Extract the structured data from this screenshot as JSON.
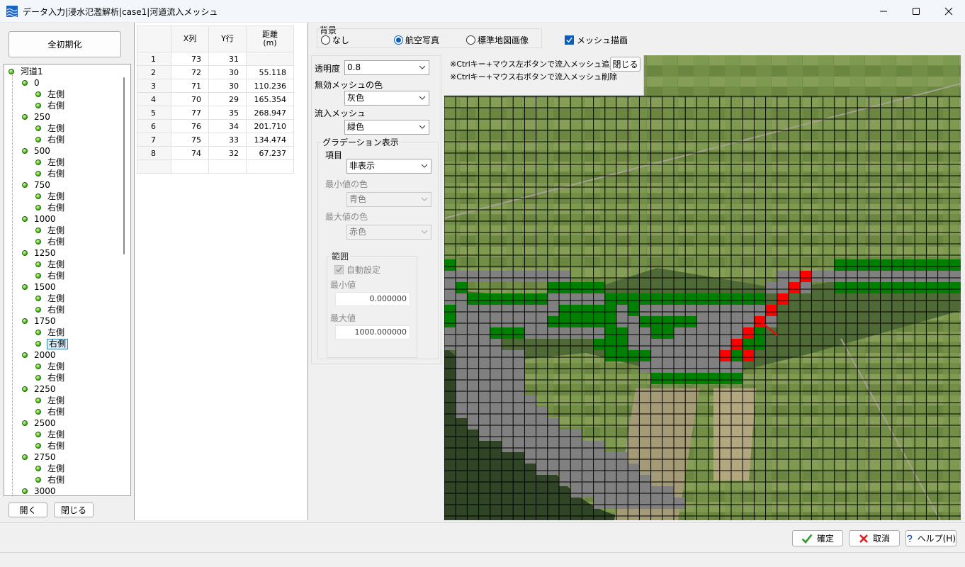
{
  "window": {
    "title": "データ入力|浸水氾濫解析|case1|河道流入メッシュ",
    "minimize": "minimize",
    "maximize": "maximize",
    "close": "close"
  },
  "left": {
    "init_button": "全初期化",
    "open_button": "開く",
    "close_button": "閉じる"
  },
  "tree": {
    "root": "河道1",
    "left_label": "左側",
    "right_label": "右側",
    "nodes": [
      "0",
      "250",
      "500",
      "750",
      "1000",
      "1250",
      "1500",
      "1750",
      "2000",
      "2250",
      "2500",
      "2750",
      "3000"
    ],
    "selected": "1750-右側"
  },
  "grid": {
    "headers": [
      "X列",
      "Y行",
      "距離\n(m)"
    ],
    "rows": [
      {
        "no": "1",
        "x": "73",
        "y": "31",
        "dist": ""
      },
      {
        "no": "2",
        "x": "72",
        "y": "30",
        "dist": "55.118"
      },
      {
        "no": "3",
        "x": "71",
        "y": "30",
        "dist": "110.236"
      },
      {
        "no": "4",
        "x": "70",
        "y": "29",
        "dist": "165.354"
      },
      {
        "no": "5",
        "x": "77",
        "y": "35",
        "dist": "268.947"
      },
      {
        "no": "6",
        "x": "76",
        "y": "34",
        "dist": "201.710"
      },
      {
        "no": "7",
        "x": "75",
        "y": "33",
        "dist": "134.474"
      },
      {
        "no": "8",
        "x": "74",
        "y": "32",
        "dist": "67.237"
      }
    ]
  },
  "background": {
    "group_label": "背景",
    "options": [
      "なし",
      "航空写真",
      "標準地図画像"
    ],
    "selected": "航空写真",
    "mesh_draw_label": "メッシュ描画",
    "mesh_draw_checked": true
  },
  "controls": {
    "transparency_label": "透明度",
    "transparency_value": "0.8",
    "invalid_color_label": "無効メッシュの色",
    "invalid_color_value": "灰色",
    "inflow_mesh_label": "流入メッシュ",
    "inflow_mesh_value": "緑色",
    "gradation_label": "グラデーション表示",
    "item_label": "項目",
    "item_value": "非表示",
    "min_color_label": "最小値の色",
    "min_color_value": "青色",
    "max_color_label": "最大値の色",
    "max_color_value": "赤色",
    "range_label": "範囲",
    "auto_label": "自動設定",
    "auto_checked": true,
    "min_label": "最小値",
    "min_value": "0.000000",
    "max_label": "最大値",
    "max_value": "1000.000000"
  },
  "notes": {
    "add_note": "※Ctrlキー+マウス左ボタンで流入メッシュ追加",
    "delete_note": "※Ctrlキー+マウス右ボタンで流入メッシュ削除",
    "close_button": "閉じる"
  },
  "footer": {
    "ok_button": "確定",
    "cancel_button": "取消",
    "help_button": "ヘルプ(H)"
  },
  "colors": {
    "inflow_mesh": "#008000",
    "invalid_mesh": "#808080",
    "selected_mesh": "#ff0000"
  }
}
